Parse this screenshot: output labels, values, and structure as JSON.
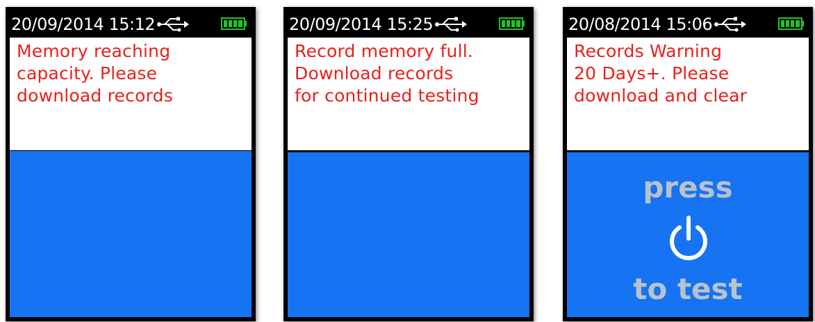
{
  "screens": [
    {
      "datetime": "20/09/2014 15:12",
      "message": "Memory reaching\ncapacity.  Please\ndownload records"
    },
    {
      "datetime": "20/09/2014 15:25",
      "message": "Record memory full.\nDownload records\nfor continued testing"
    },
    {
      "datetime": "20/08/2014 15:06",
      "message": "Records Warning\n20 Days+.  Please\ndownload and clear",
      "prompt_top": "press",
      "prompt_bottom": "to test"
    }
  ],
  "icons": {
    "usb": "usb-icon",
    "battery": "battery-icon",
    "power": "power-icon"
  },
  "colors": {
    "message_text": "#e8201c",
    "blue_panel": "#1673f2",
    "battery_green": "#22c22a",
    "prompt_text": "#b8c2cc"
  },
  "battery_level": 1.0
}
